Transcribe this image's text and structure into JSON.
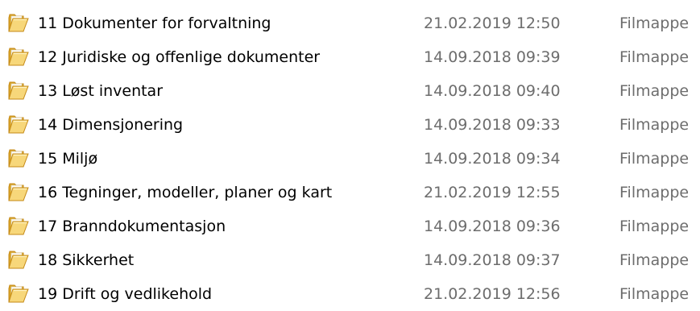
{
  "folder_icon": {
    "name": "folder-icon",
    "colors": {
      "back": "#d9a427",
      "front": "#f7d77a",
      "edge": "#c58a17",
      "paper": "#fdfbf3"
    }
  },
  "files": [
    {
      "name": "11 Dokumenter for forvaltning",
      "modified": "21.02.2019 12:50",
      "type": "Filmappe"
    },
    {
      "name": "12 Juridiske og offenlige dokumenter",
      "modified": "14.09.2018 09:39",
      "type": "Filmappe"
    },
    {
      "name": "13 Løst inventar",
      "modified": "14.09.2018 09:40",
      "type": "Filmappe"
    },
    {
      "name": "14 Dimensjonering",
      "modified": "14.09.2018 09:33",
      "type": "Filmappe"
    },
    {
      "name": "15 Miljø",
      "modified": "14.09.2018 09:34",
      "type": "Filmappe"
    },
    {
      "name": "16 Tegninger, modeller, planer og kart",
      "modified": "21.02.2019 12:55",
      "type": "Filmappe"
    },
    {
      "name": "17 Branndokumentasjon",
      "modified": "14.09.2018 09:36",
      "type": "Filmappe"
    },
    {
      "name": "18 Sikkerhet",
      "modified": "14.09.2018 09:37",
      "type": "Filmappe"
    },
    {
      "name": "19 Drift og vedlikehold",
      "modified": "21.02.2019 12:56",
      "type": "Filmappe"
    }
  ]
}
